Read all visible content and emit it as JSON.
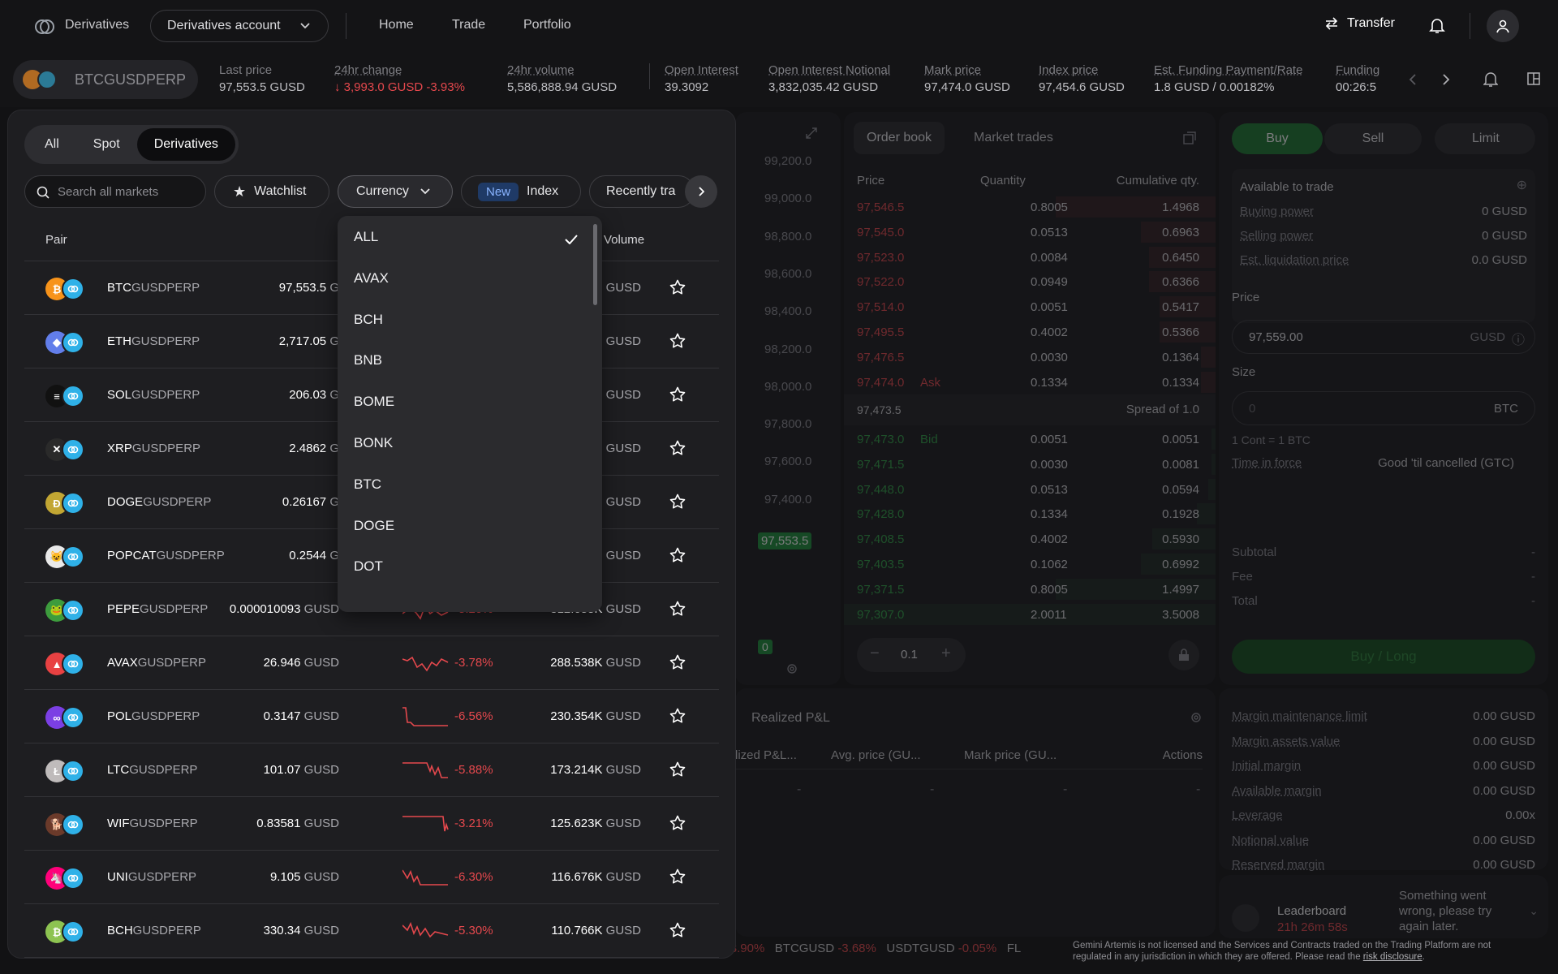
{
  "header": {
    "brand": "Derivatives",
    "account_select": "Derivatives account",
    "nav": [
      "Home",
      "Trade",
      "Portfolio"
    ],
    "transfer": "Transfer"
  },
  "ticker": {
    "symbol": "BTCGUSDPERP",
    "stats": [
      {
        "label": "Last price",
        "value": "97,553.5 GUSD"
      },
      {
        "label": "24hr change",
        "value": "↓ 3,993.0 GUSD -3.93%"
      },
      {
        "label": "24hr volume",
        "value": "5,586,888.94 GUSD"
      },
      {
        "label": "Open Interest",
        "value": "39.3092"
      },
      {
        "label": "Open Interest Notional",
        "value": "3,832,035.42 GUSD"
      },
      {
        "label": "Mark price",
        "value": "97,474.0 GUSD"
      },
      {
        "label": "Index price",
        "value": "97,454.6 GUSD"
      },
      {
        "label": "Est. Funding Payment/Rate",
        "value": "1.8 GUSD / 0.00182%"
      },
      {
        "label": "Funding",
        "value": "00:26:5"
      }
    ]
  },
  "chart": {
    "yticks": [
      "99,200.0",
      "99,000.0",
      "98,800.0",
      "98,600.0",
      "98,400.0",
      "98,200.0",
      "98,000.0",
      "97,800.0",
      "97,600.0",
      "97,400.0",
      "97,200.0"
    ],
    "last_tag": "97,553.5",
    "bottom_tag": "0"
  },
  "orderbook": {
    "tabs": [
      "Order book",
      "Market trades"
    ],
    "headers": [
      "Price",
      "Quantity",
      "Cumulative qty."
    ],
    "asks": [
      {
        "price": "97,546.5",
        "qty": "0.8005",
        "cum": "1.4968",
        "depth": 0.43
      },
      {
        "price": "97,545.0",
        "qty": "0.0513",
        "cum": "0.6963",
        "depth": 0.2
      },
      {
        "price": "97,523.0",
        "qty": "0.0084",
        "cum": "0.6450",
        "depth": 0.18
      },
      {
        "price": "97,522.0",
        "qty": "0.0949",
        "cum": "0.6366",
        "depth": 0.18
      },
      {
        "price": "97,514.0",
        "qty": "0.0051",
        "cum": "0.5417",
        "depth": 0.15
      },
      {
        "price": "97,495.5",
        "qty": "0.4002",
        "cum": "0.5366",
        "depth": 0.15
      },
      {
        "price": "97,476.5",
        "qty": "0.0030",
        "cum": "0.1364",
        "depth": 0.04
      },
      {
        "price": "97,474.0",
        "qty": "0.1334",
        "cum": "0.1334",
        "depth": 0.04,
        "tag": "Ask"
      }
    ],
    "spread_price": "97,473.5",
    "spread_text": "Spread of 1.0",
    "bids": [
      {
        "price": "97,473.0",
        "qty": "0.0051",
        "cum": "0.0051",
        "depth": 0.01,
        "tag": "Bid"
      },
      {
        "price": "97,471.5",
        "qty": "0.0030",
        "cum": "0.0081",
        "depth": 0.01
      },
      {
        "price": "97,448.0",
        "qty": "0.0513",
        "cum": "0.0594",
        "depth": 0.02
      },
      {
        "price": "97,428.0",
        "qty": "0.1334",
        "cum": "0.1928",
        "depth": 0.05
      },
      {
        "price": "97,408.5",
        "qty": "0.4002",
        "cum": "0.5930",
        "depth": 0.17
      },
      {
        "price": "97,403.5",
        "qty": "0.1062",
        "cum": "0.6992",
        "depth": 0.2
      },
      {
        "price": "97,371.5",
        "qty": "0.8005",
        "cum": "1.4997",
        "depth": 0.43
      },
      {
        "price": "97,307.0",
        "qty": "2.0011",
        "cum": "3.5008",
        "depth": 1.0
      }
    ],
    "step": "0.1"
  },
  "order_form": {
    "buy": "Buy",
    "sell": "Sell",
    "type": "Limit",
    "available_title": "Available to trade",
    "available": [
      {
        "label": "Buying power",
        "value": "0 GUSD"
      },
      {
        "label": "Selling power",
        "value": "0 GUSD"
      },
      {
        "label": "Est. liquidation price",
        "value": "0.0 GUSD"
      }
    ],
    "price_label": "Price",
    "price_value": "97,559.00",
    "price_unit": "GUSD",
    "size_label": "Size",
    "size_placeholder": "0",
    "size_unit": "BTC",
    "cont": "1 Cont = 1 BTC",
    "tif_label": "Time in force",
    "tif_value": "Good 'til cancelled (GTC)",
    "summary": [
      {
        "label": "Subtotal",
        "value": "-"
      },
      {
        "label": "Fee",
        "value": "-"
      },
      {
        "label": "Total",
        "value": "-"
      }
    ],
    "submit": "Buy / Long"
  },
  "positions": {
    "tab": "Realized P&L",
    "headers": [
      "lized P&L...",
      "Avg. price (GU...",
      "Mark price (GU...",
      "Actions"
    ],
    "values": [
      "-",
      "-",
      "-",
      "-"
    ]
  },
  "margin": [
    {
      "label": "Margin maintenance limit",
      "value": "0.00 GUSD"
    },
    {
      "label": "Margin assets value",
      "value": "0.00 GUSD"
    },
    {
      "label": "Initial margin",
      "value": "0.00 GUSD"
    },
    {
      "label": "Available margin",
      "value": "0.00 GUSD"
    },
    {
      "label": "Leverage",
      "value": "0.00x"
    },
    {
      "label": "Notional value",
      "value": "0.00 GUSD"
    },
    {
      "label": "Reserved margin",
      "value": "0.00 GUSD"
    }
  ],
  "leaderboard": {
    "title": "Leaderboard",
    "timer": "21h 26m 58s",
    "error": "Something went wrong, please try again later."
  },
  "footer": {
    "ticker": [
      {
        "sym": "RP",
        "chg": "-8.90%"
      },
      {
        "sym": "BTCGUSD",
        "chg": "-3.68%"
      },
      {
        "sym": "USDTGUSD",
        "chg": "-0.05%"
      },
      {
        "sym": "FL",
        "chg": ""
      }
    ],
    "disclaimer": "Gemini Artemis is not licensed and the Services and Contracts traded on the Trading Platform are not regulated in any jurisdiction in which they are offered. Please read the",
    "disclaimer_link": "risk disclosure"
  },
  "markets": {
    "segments": [
      "All",
      "Spot",
      "Derivatives"
    ],
    "active_segment": "Derivatives",
    "search_placeholder": "Search all markets",
    "filters": {
      "watchlist": "Watchlist",
      "currency": "Currency",
      "new_badge": "New",
      "index": "Index",
      "recent": "Recently tra"
    },
    "columns": {
      "pair": "Pair",
      "price": "P",
      "volume": "Volume"
    },
    "rows": [
      {
        "base": "BTC",
        "quote": "GUSDPERP",
        "price": "97,553.5",
        "cur": "G",
        "chg": "",
        "vol": "",
        "vcur": "GUSD",
        "color": "#f7931a",
        "glyph": "₿",
        "spark": ""
      },
      {
        "base": "ETH",
        "quote": "GUSDPERP",
        "price": "2,717.05",
        "cur": "G",
        "chg": "",
        "vol": "",
        "vcur": "GUSD",
        "color": "#627eea",
        "glyph": "◆",
        "spark": ""
      },
      {
        "base": "SOL",
        "quote": "GUSDPERP",
        "price": "206.03",
        "cur": "G",
        "chg": "",
        "vol": "",
        "vcur": "GUSD",
        "color": "#111111",
        "glyph": "≡",
        "spark": ""
      },
      {
        "base": "XRP",
        "quote": "GUSDPERP",
        "price": "2.4862",
        "cur": "G",
        "chg": "",
        "vol": "",
        "vcur": "GUSD",
        "color": "#2a2a2a",
        "glyph": "✕",
        "spark": ""
      },
      {
        "base": "DOGE",
        "quote": "GUSDPERP",
        "price": "0.26167",
        "cur": "G",
        "chg": "",
        "vol": "",
        "vcur": "GUSD",
        "color": "#c2a633",
        "glyph": "Ð",
        "spark": ""
      },
      {
        "base": "POPCAT",
        "quote": "GUSDPERP",
        "price": "0.2544",
        "cur": "G",
        "chg": "",
        "vol": "",
        "vcur": "GUSD",
        "color": "#e9e9e9",
        "glyph": "😺",
        "spark": ""
      },
      {
        "base": "PEPE",
        "quote": "GUSDPERP",
        "price": "0.000010093",
        "cur": "GUSD",
        "chg": "-5.20%",
        "vol": "312.055K",
        "vcur": "GUSD",
        "color": "#3d9c3d",
        "glyph": "🐸",
        "spark": "0,20 8,14 16,18 22,26 28,10 34,20 40,16 48,22 56,18"
      },
      {
        "base": "AVAX",
        "quote": "GUSDPERP",
        "price": "26.946",
        "cur": "GUSD",
        "chg": "-3.78%",
        "vol": "288.538K",
        "vcur": "GUSD",
        "color": "#e84142",
        "glyph": "▲",
        "spark": "0,10 6,12 12,8 18,20 24,16 30,24 36,14 42,18 48,10 56,14"
      },
      {
        "base": "POL",
        "quote": "GUSDPERP",
        "price": "0.3147",
        "cur": "GUSD",
        "chg": "-6.56%",
        "vol": "230.354K",
        "vcur": "GUSD",
        "color": "#7b3fe4",
        "glyph": "∞",
        "spark": "0,4 4,4 6,22 10,22 14,26 56,26"
      },
      {
        "base": "LTC",
        "quote": "GUSDPERP",
        "price": "101.07",
        "cur": "GUSD",
        "chg": "-5.88%",
        "vol": "173.214K",
        "vcur": "GUSD",
        "color": "#bfbbbb",
        "glyph": "Ł",
        "spark": "0,6 30,6 34,16 36,10 40,20 44,12 48,24 56,24"
      },
      {
        "base": "WIF",
        "quote": "GUSDPERP",
        "price": "0.83581",
        "cur": "GUSD",
        "chg": "-3.21%",
        "vol": "125.623K",
        "vcur": "GUSD",
        "color": "#6b3a2a",
        "glyph": "🐕",
        "spark": "0,6 50,6 52,24 54,16 56,22"
      },
      {
        "base": "UNI",
        "quote": "GUSDPERP",
        "price": "9.105",
        "cur": "GUSD",
        "chg": "-6.30%",
        "vol": "116.676K",
        "vcur": "GUSD",
        "color": "#ff007a",
        "glyph": "🦄",
        "spark": "0,6 6,16 10,8 14,20 18,14 22,24 56,24"
      },
      {
        "base": "BCH",
        "quote": "GUSDPERP",
        "price": "330.34",
        "cur": "GUSD",
        "chg": "-5.30%",
        "vol": "110.766K",
        "vcur": "GUSD",
        "color": "#8dc351",
        "glyph": "₿",
        "spark": "0,8 6,14 10,6 14,18 18,10 22,20 28,12 34,22 40,16 56,20"
      }
    ]
  },
  "currency_dropdown": {
    "selected": "ALL",
    "options": [
      "ALL",
      "AVAX",
      "BCH",
      "BNB",
      "BOME",
      "BONK",
      "BTC",
      "DOGE",
      "DOT"
    ]
  }
}
